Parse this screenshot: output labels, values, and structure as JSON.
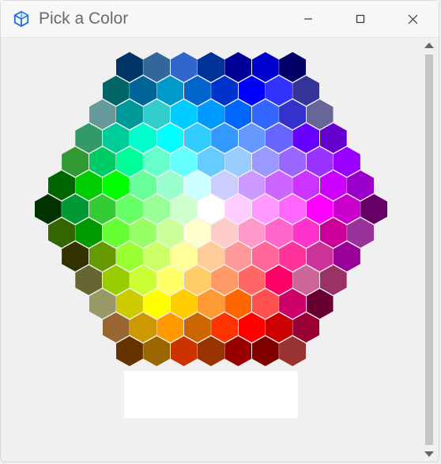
{
  "window": {
    "title": "Pick a Color"
  },
  "selected_color": "#FFFFFF",
  "hex_rows": [
    [
      "#003366",
      "#336699",
      "#3366CC",
      "#003399",
      "#000099",
      "#0000CC",
      "#000066"
    ],
    [
      "#006666",
      "#006699",
      "#0099CC",
      "#0066CC",
      "#0033CC",
      "#0000FF",
      "#3333FF",
      "#333399"
    ],
    [
      "#669999",
      "#009999",
      "#33CCCC",
      "#00CCFF",
      "#0099FF",
      "#0066FF",
      "#3366FF",
      "#3333CC",
      "#666699"
    ],
    [
      "#339966",
      "#00CC99",
      "#00FFCC",
      "#00FFFF",
      "#33CCFF",
      "#3399FF",
      "#6699FF",
      "#6666FF",
      "#6600FF",
      "#6600CC"
    ],
    [
      "#339933",
      "#00CC66",
      "#00FF99",
      "#66FFCC",
      "#66FFFF",
      "#66CCFF",
      "#99CCFF",
      "#9999FF",
      "#9966FF",
      "#9933FF",
      "#9900FF"
    ],
    [
      "#006600",
      "#00CC00",
      "#00FF00",
      "#66FF99",
      "#99FFCC",
      "#CCFFFF",
      "#CCCCFF",
      "#CC99FF",
      "#CC66FF",
      "#CC33FF",
      "#CC00FF",
      "#9900CC"
    ],
    [
      "#003300",
      "#009933",
      "#33CC33",
      "#66FF66",
      "#99FF99",
      "#CCFFCC",
      "#FFFFFF",
      "#FFCCFF",
      "#FF99FF",
      "#FF66FF",
      "#FF00FF",
      "#CC00CC",
      "#660066"
    ],
    [
      "#336600",
      "#009900",
      "#66FF33",
      "#99FF66",
      "#CCFF99",
      "#FFFFCC",
      "#FFCCCC",
      "#FF99CC",
      "#FF66CC",
      "#FF33CC",
      "#CC0099",
      "#993399"
    ],
    [
      "#333300",
      "#669900",
      "#99FF33",
      "#CCFF66",
      "#FFFF99",
      "#FFCC99",
      "#FF9999",
      "#FF6699",
      "#FF3399",
      "#CC3399",
      "#990099"
    ],
    [
      "#666633",
      "#99CC00",
      "#CCFF33",
      "#FFFF66",
      "#FFCC66",
      "#FF9966",
      "#FF6666",
      "#FF0066",
      "#CC6699",
      "#993366"
    ],
    [
      "#999966",
      "#CCCC00",
      "#FFFF00",
      "#FFCC00",
      "#FF9933",
      "#FF6600",
      "#FF5050",
      "#CC0066",
      "#660033"
    ],
    [
      "#996633",
      "#CC9900",
      "#FF9900",
      "#CC6600",
      "#FF3300",
      "#FF0000",
      "#CC0000",
      "#990033"
    ],
    [
      "#663300",
      "#996600",
      "#CC3300",
      "#993300",
      "#990000",
      "#800000",
      "#993333"
    ]
  ]
}
